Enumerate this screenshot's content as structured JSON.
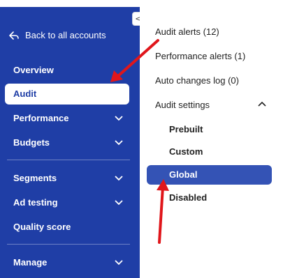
{
  "sidebar": {
    "back_label": "Back to all accounts",
    "items": [
      {
        "label": "Overview"
      },
      {
        "label": "Audit"
      },
      {
        "label": "Performance"
      },
      {
        "label": "Budgets"
      },
      {
        "label": "Segments"
      },
      {
        "label": "Ad testing"
      },
      {
        "label": "Quality score"
      },
      {
        "label": "Manage"
      }
    ]
  },
  "panel": {
    "items": [
      {
        "label": "Audit alerts (12)"
      },
      {
        "label": "Performance alerts (1)"
      },
      {
        "label": "Auto changes log (0)"
      },
      {
        "label": "Audit settings"
      }
    ],
    "settings": [
      {
        "label": "Prebuilt"
      },
      {
        "label": "Custom"
      },
      {
        "label": "Global"
      },
      {
        "label": "Disabled"
      }
    ]
  },
  "collapse_toggle": "<>",
  "colors": {
    "sidebar_bg": "#1f3ea6",
    "active_panel_bg": "#3453b5",
    "annotation_arrow": "#e0161b"
  }
}
